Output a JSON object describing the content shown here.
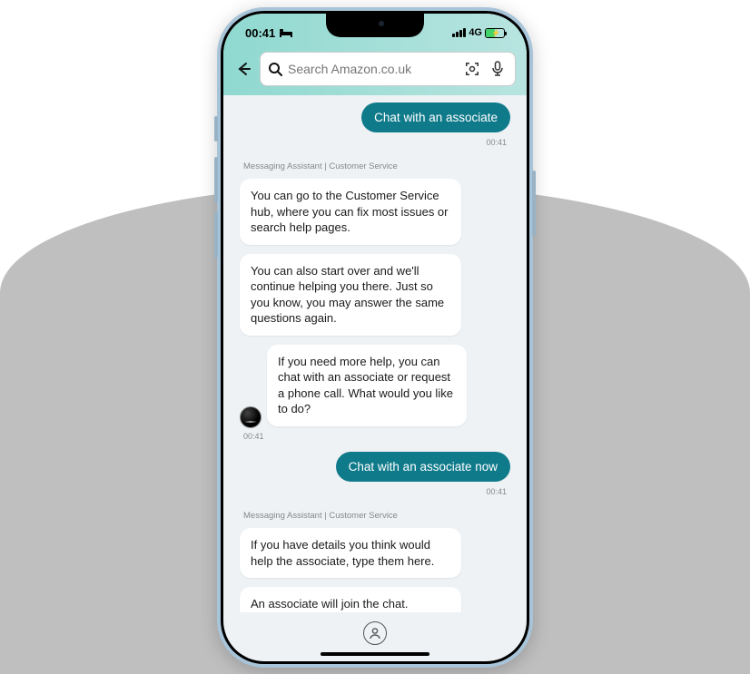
{
  "status": {
    "time": "00:41",
    "network": "4G"
  },
  "search": {
    "placeholder": "Search Amazon.co.uk"
  },
  "chat": {
    "user1": "Chat with an associate",
    "ts1": "00:41",
    "sender1": "Messaging Assistant | Customer Service",
    "bot1": "You can go to the Customer Service hub, where you can fix most issues or search help pages.",
    "bot2": "You can also start over and we'll continue helping you there. Just so you know, you may answer the same questions again.",
    "bot3": "If you need more help, you can chat with an associate or request a phone call. What would you like to do?",
    "ts2": "00:41",
    "user2": "Chat with an associate now",
    "ts3": "00:41",
    "sender2": "Messaging Assistant | Customer Service",
    "bot4": "If you have details you think would help the associate, type them here.",
    "bot5": "An associate will join the chat."
  }
}
